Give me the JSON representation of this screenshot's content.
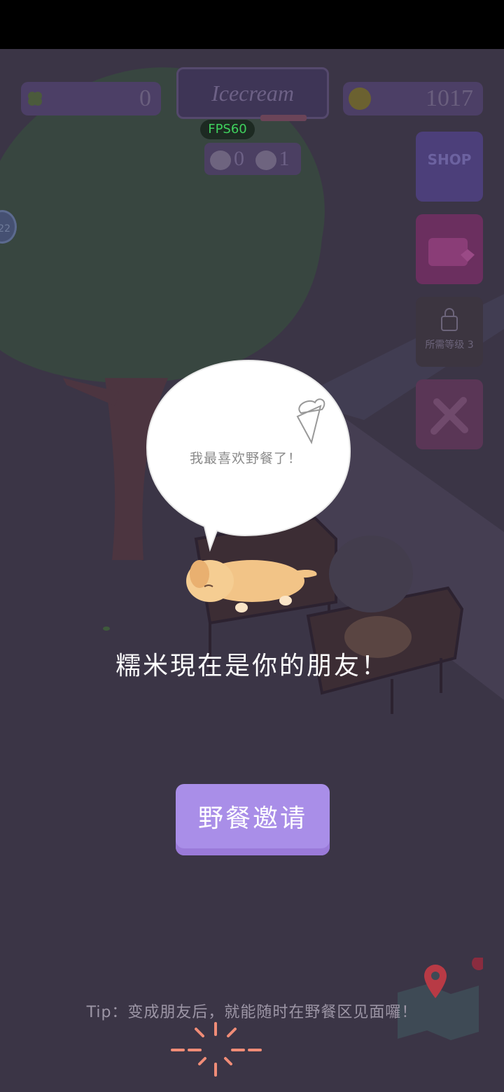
{
  "hud": {
    "clover_count": "0",
    "coin_count": "1017",
    "title": "Icecream",
    "fps": "FPS60",
    "dog_count": "0",
    "cat_count": "1",
    "level": "22"
  },
  "sidebar": {
    "shop_label": "SHOP",
    "locked_label": "所需等级 3"
  },
  "dialog": {
    "speech": "我最喜欢野餐了！",
    "friend_message": "糯米現在是你的朋友！",
    "invite_button": "野餐邀请",
    "tip": "Tip：变成朋友后，就能随时在野餐区见面囉！"
  },
  "colors": {
    "button": "#a98ee8",
    "overlay_bg": "#3b3546",
    "fps_green": "#3fd15d"
  }
}
